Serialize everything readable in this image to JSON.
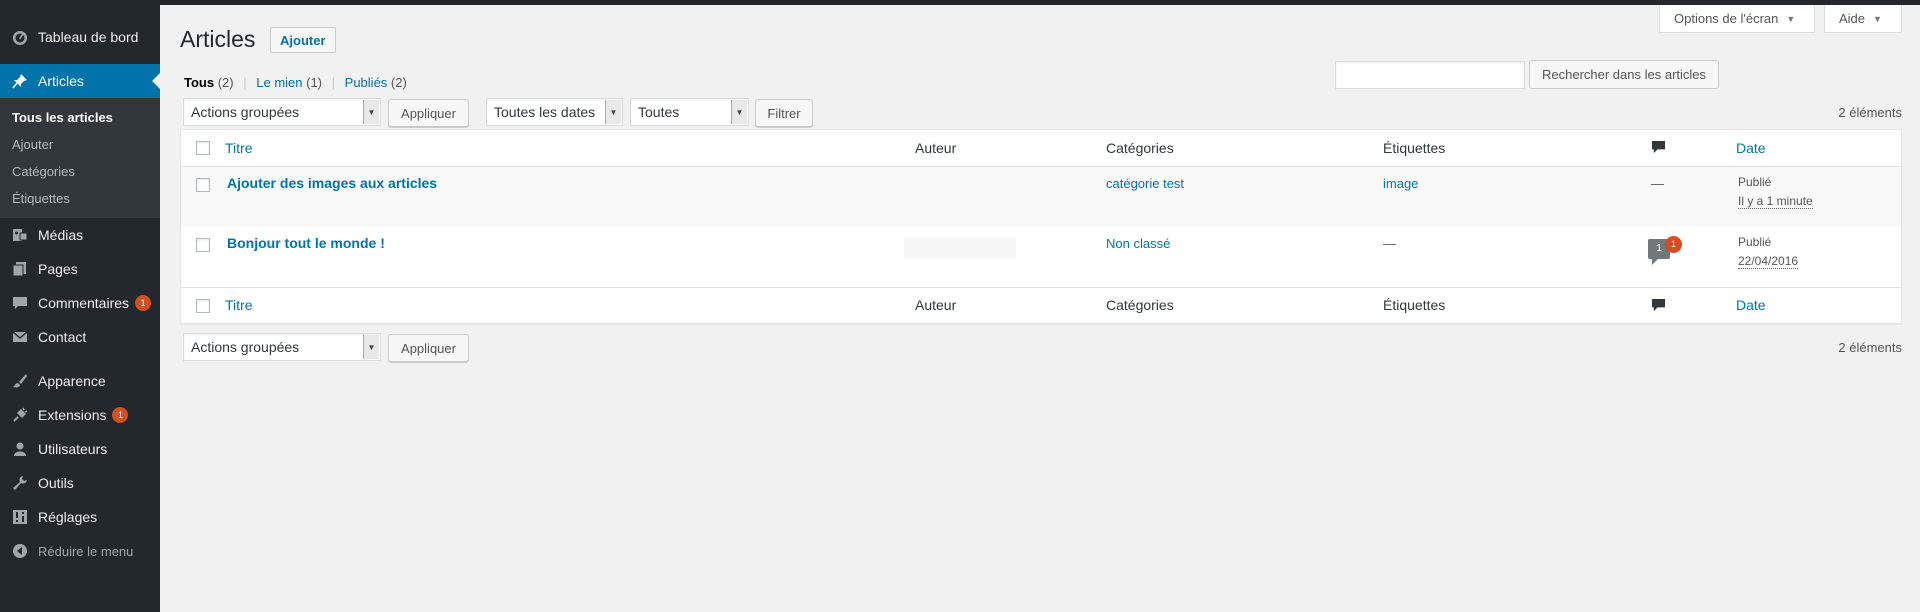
{
  "sidebar": {
    "items": [
      {
        "label": "Tableau de bord",
        "icon": "dashboard-icon"
      },
      {
        "label": "Articles",
        "icon": "pin-icon"
      },
      {
        "label": "Médias",
        "icon": "media-icon"
      },
      {
        "label": "Pages",
        "icon": "pages-icon"
      },
      {
        "label": "Commentaires",
        "icon": "comments-icon",
        "badge": "1"
      },
      {
        "label": "Contact",
        "icon": "mail-icon"
      },
      {
        "label": "Apparence",
        "icon": "brush-icon"
      },
      {
        "label": "Extensions",
        "icon": "plugin-icon",
        "badge": "1"
      },
      {
        "label": "Utilisateurs",
        "icon": "user-icon"
      },
      {
        "label": "Outils",
        "icon": "wrench-icon"
      },
      {
        "label": "Réglages",
        "icon": "settings-icon"
      }
    ],
    "submenu": [
      "Tous les articles",
      "Ajouter",
      "Catégories",
      "Étiquettes"
    ],
    "collapse_label": "Réduire le menu"
  },
  "screen_options": {
    "options_label": "Options de l'écran",
    "help_label": "Aide"
  },
  "page": {
    "title": "Articles",
    "add_label": "Ajouter"
  },
  "filters_nav": {
    "all_label": "Tous",
    "all_count": "(2)",
    "mine_label": "Le mien",
    "mine_count": "(1)",
    "published_label": "Publiés",
    "published_count": "(2)"
  },
  "search": {
    "placeholder": "",
    "button_label": "Rechercher dans les articles"
  },
  "tablenav_top": {
    "bulk_action": "Actions groupées",
    "apply_label": "Appliquer",
    "dates_filter": "Toutes les dates",
    "category_filter": "Toutes",
    "filter_label": "Filtrer",
    "count": "2 éléments"
  },
  "table": {
    "columns": {
      "title": "Titre",
      "author": "Auteur",
      "categories": "Catégories",
      "tags": "Étiquettes",
      "date": "Date"
    },
    "rows": [
      {
        "title": "Ajouter des images aux articles",
        "author": "",
        "category": "catégorie test",
        "tags": "image",
        "comments": "—",
        "status": "Publié",
        "date": "Il y a 1 minute"
      },
      {
        "title": "Bonjour tout le monde !",
        "author": "",
        "category": "Non classé",
        "tags": "—",
        "comments": "1",
        "pending": "1",
        "status": "Publié",
        "date": "22/04/2016"
      }
    ]
  },
  "tablenav_bottom": {
    "bulk_action": "Actions groupées",
    "apply_label": "Appliquer",
    "count": "2 éléments"
  },
  "colors": {
    "sidebar_bg": "#23282d",
    "active": "#0073aa",
    "link": "#0073aa",
    "badge": "#d54e21",
    "page_bg": "#f1f1f1"
  }
}
